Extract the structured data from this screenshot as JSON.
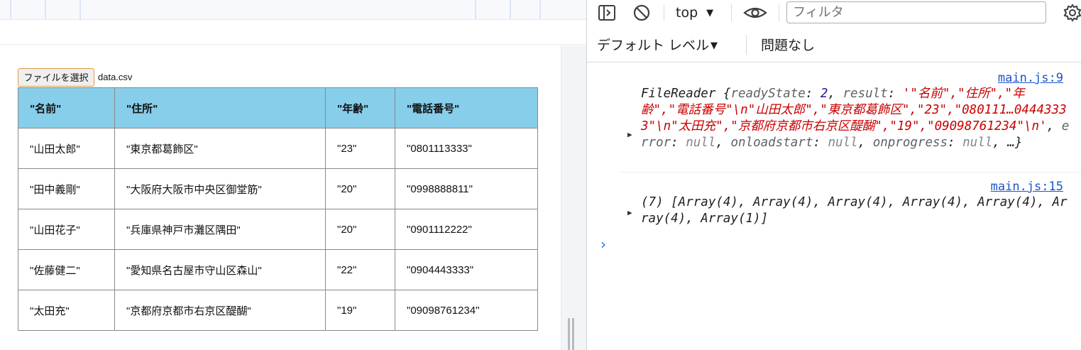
{
  "page": {
    "file_button_label": "ファイルを選択",
    "file_name": "data.csv",
    "table": {
      "headers": [
        "\"名前\"",
        "\"住所\"",
        "\"年齢\"",
        "\"電話番号\""
      ],
      "rows": [
        [
          "\"山田太郎\"",
          "\"東京都葛飾区\"",
          "\"23\"",
          "\"0801113333\""
        ],
        [
          "\"田中義剛\"",
          "\"大阪府大阪市中央区御堂筋\"",
          "\"20\"",
          "\"0998888811\""
        ],
        [
          "\"山田花子\"",
          "\"兵庫県神戸市灘区隅田\"",
          "\"20\"",
          "\"0901112222\""
        ],
        [
          "\"佐藤健二\"",
          "\"愛知県名古屋市守山区森山\"",
          "\"22\"",
          "\"0904443333\""
        ],
        [
          "\"太田充\"",
          "\"京都府京都市右京区醍醐\"",
          "\"19\"",
          "\"09098761234\""
        ]
      ]
    }
  },
  "devtools": {
    "context_label": "top",
    "filter_placeholder": "フィルタ",
    "levels_label": "デフォルト レベル",
    "issues_label": "問題なし",
    "icons": {
      "sidebar": "sidebar-toggle-icon",
      "clear": "clear-console-icon",
      "eye": "live-expression-eye-icon",
      "settings": "settings-gear-icon"
    },
    "colors": {
      "link": "#1a55c9",
      "string": "#c80000",
      "number": "#1a1aa6",
      "prompt": "#1a73e8",
      "table_header": "#87ceea"
    },
    "messages": [
      {
        "source": "main.js:9",
        "parts": {
          "p1": "FileReader {",
          "k1": "readyState",
          "p2": ": ",
          "v1": "2",
          "p3": ", ",
          "k2": "result",
          "p4": ": ",
          "v2": "'\"名前\",\"住所\",\"年齢\",\"電話番号\"\\n\"山田太郎\",\"東京都葛飾区\",\"23\",\"080111…04443333\"\\n\"太田充\",\"京都府京都市右京区醍醐\",\"19\",\"09098761234\"\\n'",
          "p5": ", ",
          "k3": "error",
          "p6": ": ",
          "v3": "null",
          "p7": ", ",
          "k4": "onloadstart",
          "p8": ": ",
          "v4": "null",
          "p9": ", ",
          "k5": "onprogress",
          "p10": ": ",
          "v5": "null",
          "p11": ", …}"
        }
      },
      {
        "source": "main.js:15",
        "text": "(7) [Array(4), Array(4), Array(4), Array(4), Array(4), Array(4), Array(1)]"
      }
    ]
  }
}
